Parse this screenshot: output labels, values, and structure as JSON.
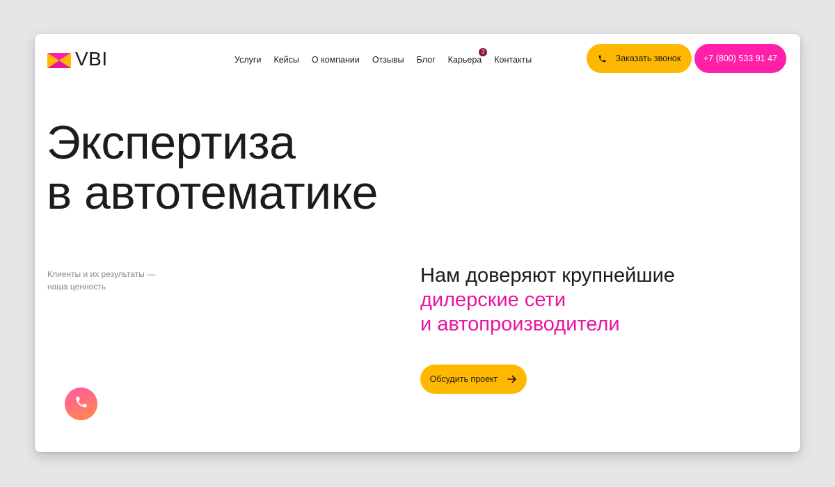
{
  "logo": {
    "text": "VBI"
  },
  "nav": {
    "items": [
      {
        "label": "Услуги"
      },
      {
        "label": "Кейсы"
      },
      {
        "label": "О компании"
      },
      {
        "label": "Отзывы"
      },
      {
        "label": "Блог"
      },
      {
        "label": "Карьера",
        "badge": "3"
      },
      {
        "label": "Контакты"
      }
    ]
  },
  "header": {
    "callback_label": "Заказать звонок",
    "phone_label": "+7 (800) 533 91 47"
  },
  "hero": {
    "title_line1": "Экспертиза",
    "title_line2": "в автотематике",
    "caption_line1": "Клиенты и их результаты —",
    "caption_line2": "наша ценность",
    "trust_line1": "Нам доверяют крупнейшие",
    "trust_line2": "дилерские сети",
    "trust_line3": "и автопроизводители",
    "cta_label": "Обсудить проект"
  },
  "icons": {
    "logo": "vbi-logo-icon",
    "callback": "phone-icon",
    "cta": "arrow-right-icon",
    "floating": "phone-icon"
  },
  "colors": {
    "yellow": "#ffb800",
    "pink": "#ff1fa8",
    "accent_text": "#e8159f",
    "badge": "#8b1232"
  }
}
